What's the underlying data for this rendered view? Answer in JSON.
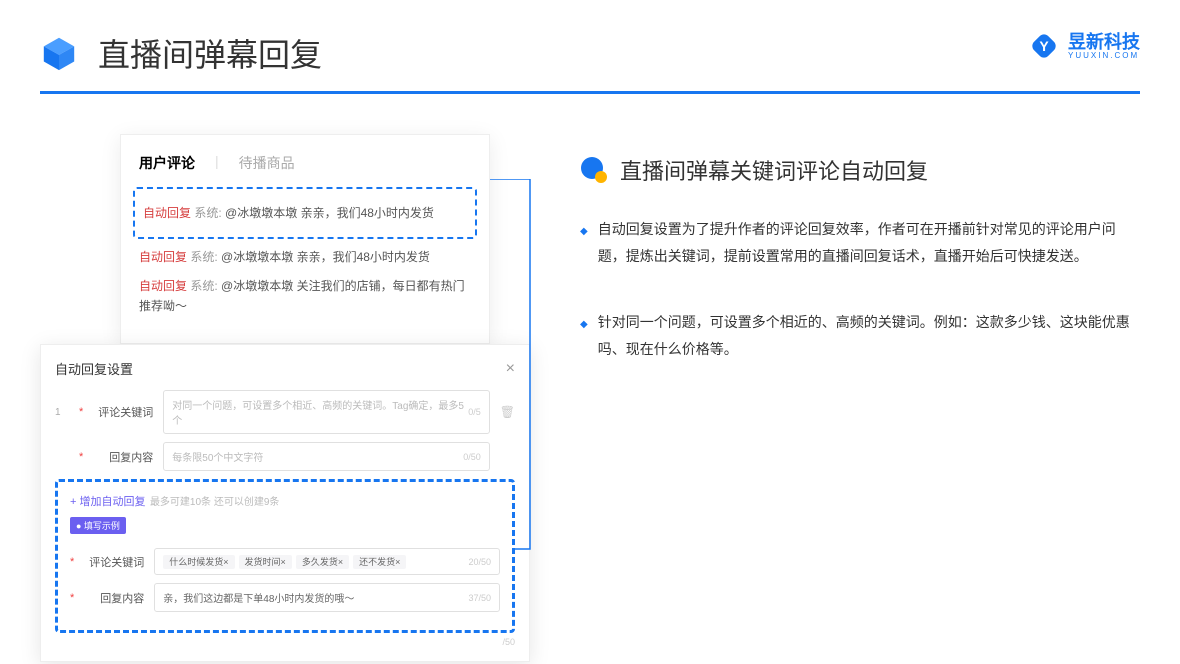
{
  "header": {
    "title": "直播间弹幕回复"
  },
  "brand": {
    "name": "昱新科技",
    "sub": "YUUXIN.COM"
  },
  "card1": {
    "tab_active": "用户评论",
    "tab_other": "待播商品",
    "msg1_tag": "自动回复",
    "msg1_sys": "系统:",
    "msg1_body": "@冰墩墩本墩 亲亲，我们48小时内发货",
    "msg2_tag": "自动回复",
    "msg2_sys": "系统:",
    "msg2_body": "@冰墩墩本墩 亲亲，我们48小时内发货",
    "msg3_tag": "自动回复",
    "msg3_sys": "系统:",
    "msg3_body": "@冰墩墩本墩 关注我们的店铺，每日都有热门推荐呦～"
  },
  "card2": {
    "title": "自动回复设置",
    "row_num": "1",
    "lbl_keyword": "评论关键词",
    "ph_keyword": "对同一个问题，可设置多个相近、高频的关键词。Tag确定，最多5个",
    "cnt_keyword": "0/5",
    "lbl_content": "回复内容",
    "ph_content": "每条限50个中文字符",
    "cnt_content": "0/50",
    "add_link": "+ 增加自动回复",
    "add_hint": "最多可建10条 还可以创建9条",
    "ex_badge": "● 填写示例",
    "ex_lbl_keyword": "评论关键词",
    "ex_tags": [
      "什么时候发货×",
      "发货时间×",
      "多久发货×",
      "还不发货×"
    ],
    "ex_cnt_keyword": "20/50",
    "ex_lbl_content": "回复内容",
    "ex_content": "亲，我们这边都是下单48小时内发货的哦～",
    "ex_cnt_content": "37/50",
    "spare_cnt": "/50"
  },
  "right": {
    "section_title": "直播间弹幕关键词评论自动回复",
    "bullet1": "自动回复设置为了提升作者的评论回复效率，作者可在开播前针对常见的评论用户问题，提炼出关键词，提前设置常用的直播间回复话术，直播开始后可快捷发送。",
    "bullet2": "针对同一个问题，可设置多个相近的、高频的关键词。例如：这款多少钱、这块能优惠吗、现在什么价格等。"
  }
}
